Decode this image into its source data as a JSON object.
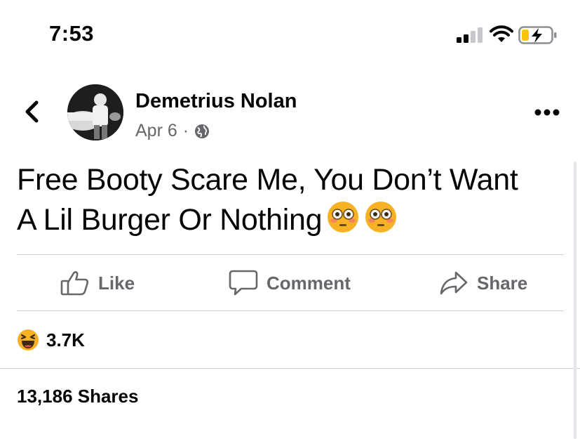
{
  "status_bar": {
    "time": "7:53",
    "icons": [
      "cellular-signal-icon",
      "wifi-icon",
      "battery-charging-icon"
    ]
  },
  "post": {
    "author": "Demetrius Nolan",
    "date": "Apr 6",
    "separator": "·",
    "audience_icon": "globe-icon",
    "text_line1": "Free Booty Scare Me, You Don’t Want",
    "text_line2": "A Lil Burger Or Nothing",
    "emojis": [
      "flushed-face-emoji",
      "flushed-face-emoji"
    ]
  },
  "actions": {
    "like": "Like",
    "comment": "Comment",
    "share": "Share"
  },
  "stats": {
    "reaction_icon": "haha-reaction-icon",
    "reaction_count": "3.7K",
    "shares": "13,186 Shares"
  },
  "colors": {
    "text": "#050505",
    "secondary": "#65676b",
    "divider": "#ced0d4",
    "battery_charge": "#f7c600",
    "reaction_yellow": "#f7b125"
  }
}
